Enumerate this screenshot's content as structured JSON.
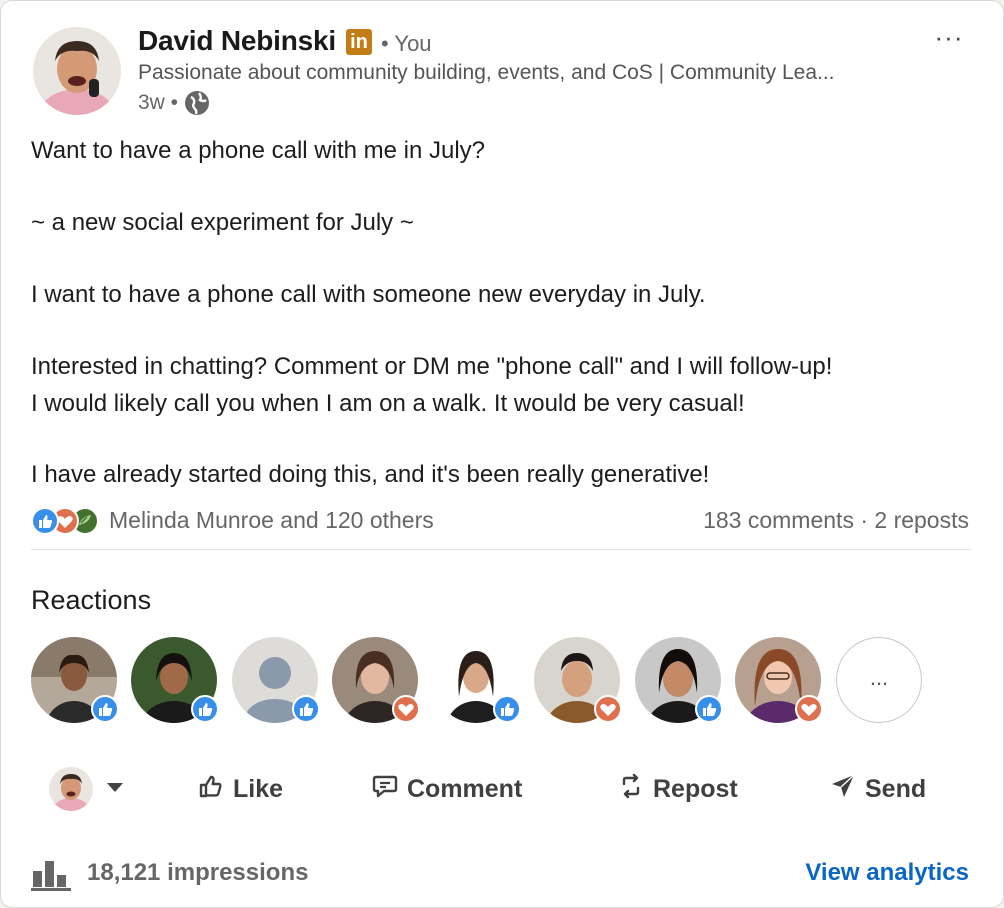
{
  "author": {
    "name": "David Nebinski",
    "badge": "in",
    "relation": "• You",
    "headline": "Passionate about community building, events, and CoS | Community Lea...",
    "age": "3w •"
  },
  "menu": {
    "more": "···"
  },
  "post": {
    "lines": [
      "Want to have a phone call with me in July?",
      "~ a new social experiment for July ~",
      "I want to have a phone call with someone new everyday in July.",
      "Interested in chatting? Comment or DM me \"phone call\" and I will follow-up!",
      "I would likely call you when I am on a walk. It would be very casual!",
      "I have already started doing this, and it's been really generative!"
    ]
  },
  "social": {
    "reactors": "Melinda Munroe and 120 others",
    "counts": "183 comments · 2 reposts"
  },
  "reactions": {
    "heading": "Reactions",
    "people": [
      {
        "reaction": "like-icon"
      },
      {
        "reaction": "like-icon"
      },
      {
        "reaction": "like-icon"
      },
      {
        "reaction": "love-icon"
      },
      {
        "reaction": "like-icon"
      },
      {
        "reaction": "love-icon"
      },
      {
        "reaction": "like-icon"
      },
      {
        "reaction": "love-icon"
      }
    ],
    "more": "..."
  },
  "actions": {
    "like": "Like",
    "comment": "Comment",
    "repost": "Repost",
    "send": "Send"
  },
  "footer": {
    "impressions": "18,121 impressions",
    "view_analytics": "View analytics"
  },
  "colors": {
    "like": "#378fe9",
    "love": "#df704d",
    "insightful": "#44712e",
    "link": "#0a66c2",
    "premium_badge": "#c37d16"
  }
}
